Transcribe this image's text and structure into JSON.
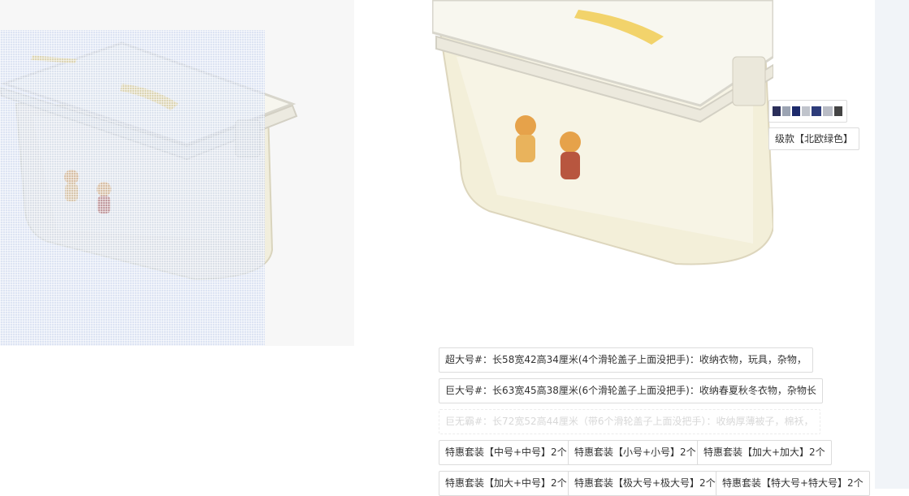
{
  "options": {
    "row1": [
      {
        "label": "超大号#：长58宽42高34厘米(4个滑轮盖子上面没把手)：收纳衣物，玩具，杂物，"
      },
      {
        "label": "巨大号#：长63宽45高38厘米(6个滑轮盖子上面没把手)：收纳春夏秋冬衣物，杂物长"
      },
      {
        "label": "巨无霸#：长72宽52高44厘米（带6个滑轮盖子上面没把手）：收纳厚薄被子，棉袄，",
        "state": "disabled"
      }
    ],
    "bundle_row1": [
      "特惠套装【中号+中号】2个",
      "特惠套装【小号+小号】2个",
      "特惠套装【加大+加大】2个"
    ],
    "bundle_row2": [
      "特惠套装【加大+中号】2个",
      "特惠套装【极大号+极大号】2个",
      "特惠套装【特大号+特大号】2个"
    ],
    "partial_chip": "级款【北欧绿色】"
  },
  "colors": {
    "box_body": "#f3efd9",
    "lid": "#f7f5ea",
    "handle": "#f2d36b",
    "magnifier": "#c8d6f0",
    "right_strip": "#f1f4f8"
  },
  "icons": [
    "storage-box-product-image",
    "bear-decal"
  ]
}
